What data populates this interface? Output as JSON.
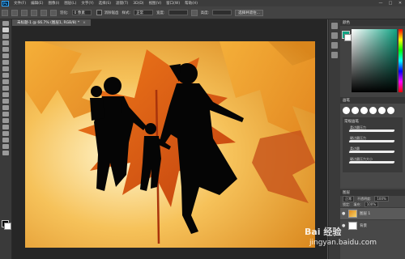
{
  "app": {
    "logo": "Ps"
  },
  "menubar": {
    "items": [
      "文件(F)",
      "编辑(E)",
      "图像(I)",
      "图层(L)",
      "文字(Y)",
      "选择(S)",
      "滤镜(T)",
      "3D(D)",
      "视图(V)",
      "窗口(W)",
      "帮助(H)"
    ],
    "minimize": "—",
    "maximize": "□",
    "close": "✕"
  },
  "options": {
    "feather_label": "羽化:",
    "feather_value": "0 像素",
    "antialias_label": "消除锯齿",
    "style_label": "样式:",
    "style_value": "正常",
    "width_label": "宽度:",
    "height_label": "高度:",
    "select_subject": "选择并遮住..."
  },
  "document": {
    "tab_title": "未标题-1 @ 66.7% (图层1, RGB/8) *",
    "close": "×"
  },
  "colors": {
    "foreground": "#10a383",
    "background": "#ffffff",
    "accent": "#31a8ff"
  },
  "panels": {
    "color_title": "颜色",
    "brush_title": "画笔",
    "brush_group": "常规画笔",
    "brush_presets": [
      "柔边圆压力",
      "硬边圆压力",
      "柔边圆",
      "硬边圆压力大小"
    ],
    "layers_title": "图层",
    "blend_mode": "正常",
    "opacity_label": "不透明度:",
    "opacity_value": "100%",
    "lock_label": "锁定:",
    "fill_label": "填充:",
    "fill_value": "100%",
    "layers": [
      {
        "name": "图层 1",
        "visible_icon": "●"
      },
      {
        "name": "背景",
        "visible_icon": "●"
      }
    ]
  },
  "watermark": {
    "line1": "Bai 经验",
    "line2": "jingyan.baidu.com"
  }
}
